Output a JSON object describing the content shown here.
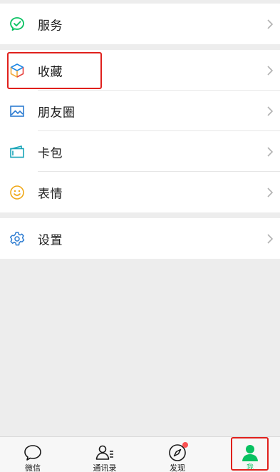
{
  "menu": {
    "service": {
      "label": "服务",
      "icon": "wechat-pay-icon"
    },
    "favorites": {
      "label": "收藏",
      "icon": "cube-icon"
    },
    "moments": {
      "label": "朋友圈",
      "icon": "image-icon"
    },
    "cards": {
      "label": "卡包",
      "icon": "card-icon"
    },
    "stickers": {
      "label": "表情",
      "icon": "smiley-icon"
    },
    "settings": {
      "label": "设置",
      "icon": "gear-icon"
    }
  },
  "tabbar": {
    "chats": "微信",
    "contacts": "通讯录",
    "discover": "发现",
    "me": "我"
  },
  "colors": {
    "accent": "#07c160",
    "highlight": "#e0201c",
    "badge": "#fa5151"
  }
}
